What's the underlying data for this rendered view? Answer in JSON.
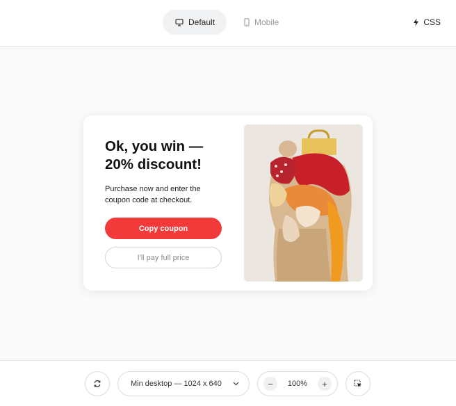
{
  "header": {
    "tabs": [
      {
        "label": "Default",
        "icon": "desktop-icon",
        "active": true
      },
      {
        "label": "Mobile",
        "icon": "mobile-icon",
        "active": false
      }
    ],
    "css_label": "CSS",
    "css_icon": "lightning-icon"
  },
  "popup": {
    "headline": "Ok, you win — 20% discount!",
    "body": "Purchase now and enter the coupon code at checkout.",
    "primary_label": "Copy coupon",
    "secondary_label": "I'll pay full price",
    "image": "clothing-pile-photo",
    "accent_color": "#f23a3a"
  },
  "toolbar": {
    "device_label": "Min desktop — 1024 x 640",
    "zoom_value": "100%",
    "zoom_out_label": "−",
    "zoom_in_label": "+"
  }
}
